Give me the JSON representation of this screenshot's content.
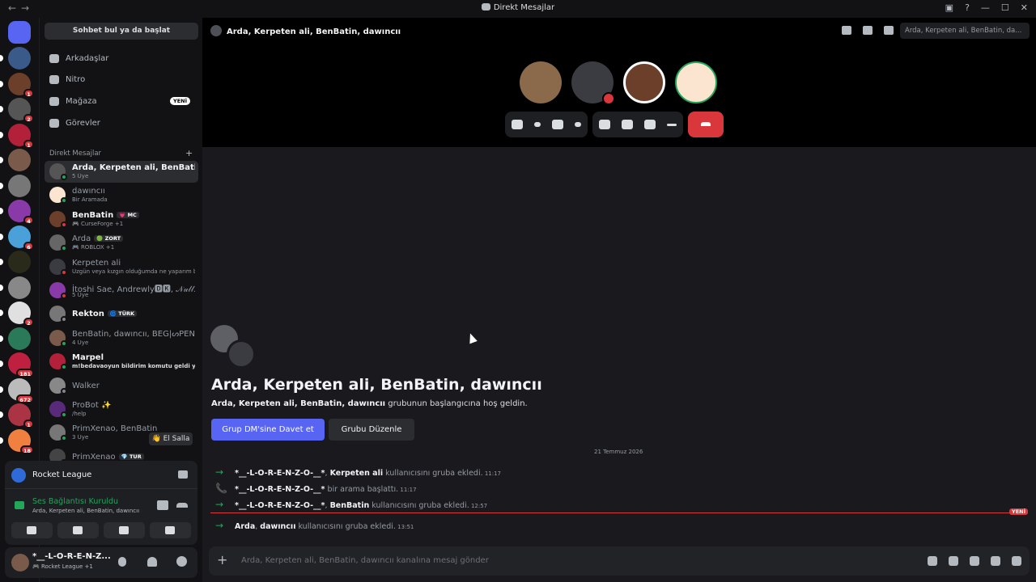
{
  "window": {
    "title": "Direkt Mesajlar"
  },
  "sidebar": {
    "search_button": "Sohbet bul ya da başlat",
    "nav": [
      {
        "label": "Arkadaşlar",
        "icon": "friends-icon"
      },
      {
        "label": "Nitro",
        "icon": "nitro-icon"
      },
      {
        "label": "Mağaza",
        "icon": "shop-icon",
        "badge": "YENİ"
      },
      {
        "label": "Görevler",
        "icon": "quests-icon"
      }
    ],
    "dm_header": "Direkt Mesajlar",
    "dms": [
      {
        "name": "Arda, Kerpeten ali, BenBatin, d...",
        "sub": "5 Üye",
        "bold": true,
        "active": true
      },
      {
        "name": "dawıncıı",
        "sub": "Bir Aramada",
        "bold": false
      },
      {
        "name": "BenBatin",
        "tag": "💗 MC",
        "sub": "🎮 CurseForge +1",
        "bold": true
      },
      {
        "name": "Arda",
        "tag": "🟢 ZORT",
        "sub": "🎮 ROBLOX +1",
        "bold": false
      },
      {
        "name": "Kerpeten ali",
        "sub": "Üzgün veya kızgın olduğumda ne yaparım b...",
        "bold": false
      },
      {
        "name": "İtoshi Sae, Andrewly🅳🅺, 𝒩𝓊𝓁𝓁...",
        "sub": "5 Üye",
        "bold": false
      },
      {
        "name": "Rekton",
        "tag": "🌀 TÜRK",
        "sub": "",
        "bold": true
      },
      {
        "name": "BenBatin, dawıncıı, BEG|ᔕPEN...",
        "sub": "4 Üye",
        "bold": false
      },
      {
        "name": "Marpel",
        "sub": "m!bedavaoyun bildirim komutu geldi yenili...",
        "bold": true,
        "sub_hl": true
      },
      {
        "name": "Walker",
        "sub": "",
        "bold": false
      },
      {
        "name": "ProBot ✨",
        "sub": "/help",
        "bold": false
      },
      {
        "name": "PrimXenao, BenBatin",
        "sub": "3 Üye",
        "bold": false
      },
      {
        "name": "PrimXenao",
        "tag": "💎 TUR",
        "sub": "",
        "bold": false
      }
    ],
    "wave_button": "👋 El Salla",
    "game": {
      "name": "Rocket League"
    },
    "voice": {
      "status": "Ses Bağlantısı Kuruldu",
      "channel": "Arda, Kerpeten ali, BenBatin, dawıncıı"
    },
    "user": {
      "name": "*__-L-O-R-E-N-Z...",
      "activity": "🎮 Rocket League +1"
    }
  },
  "servers": [
    {
      "color": "#5865f2",
      "badge": "",
      "pip": false
    },
    {
      "color": "#3a5a8a",
      "badge": "",
      "pip": true
    },
    {
      "color": "#6b3f2a",
      "badge": "1",
      "pip": true
    },
    {
      "color": "#555",
      "badge": "2",
      "pip": true
    },
    {
      "color": "#b3203a",
      "badge": "1",
      "pip": true
    },
    {
      "color": "#7a5a4a",
      "badge": "",
      "pip": true
    },
    {
      "color": "#777",
      "badge": "",
      "pip": true
    },
    {
      "color": "#8a3aa8",
      "badge": "4",
      "pip": true
    },
    {
      "color": "#4aa0d8",
      "badge": "6",
      "pip": true
    },
    {
      "color": "#2a2a1a",
      "badge": "",
      "pip": true
    },
    {
      "color": "#888",
      "badge": "",
      "pip": true
    },
    {
      "color": "#e0e0e0",
      "badge": "2",
      "pip": true
    },
    {
      "color": "#2a7a5a",
      "badge": "",
      "pip": true
    },
    {
      "color": "#c02040",
      "badge": "181",
      "pip": true
    },
    {
      "color": "#bbb",
      "badge": "672",
      "pip": true
    },
    {
      "color": "#aa3344",
      "badge": "1",
      "pip": true
    },
    {
      "color": "#f08040",
      "badge": "18",
      "pip": true
    }
  ],
  "main": {
    "channel_title": "Arda, Kerpeten ali, BenBatin, dawıncıı",
    "search_placeholder": "Arda, Kerpeten ali, BenBatin, da...",
    "welcome_title": "Arda, Kerpeten ali, BenBatin, dawıncıı",
    "welcome_names": "Arda, Kerpeten ali, BenBatin, dawıncıı",
    "welcome_suffix": " grubunun başlangıcına hoş geldin.",
    "invite_button": "Grup DM'sine Davet et",
    "edit_button": "Grubu Düzenle",
    "date": "21 Temmuz 2026",
    "new_badge": "YENİ",
    "messages": [
      {
        "icon": "→",
        "actor": "*__-L-O-R-E-N-Z-O-__*",
        "target": "Kerpeten ali",
        "text": " kullanıcısını gruba ekledi.",
        "time": "11:17"
      },
      {
        "icon": "📞",
        "actor": "*__-L-O-R-E-N-Z-O-__*",
        "target": "",
        "text": " bir arama başlattı.",
        "time": "11:17"
      },
      {
        "icon": "→",
        "actor": "*__-L-O-R-E-N-Z-O-__*",
        "target": "BenBatin",
        "text": " kullanıcısını gruba ekledi.",
        "time": "12:57"
      },
      {
        "icon": "→",
        "actor": "Arda",
        "target": "dawıncıı",
        "text": " kullanıcısını gruba ekledi.",
        "time": "13:51"
      }
    ],
    "composer_placeholder": "Arda, Kerpeten ali, BenBatin, dawıncıı kanalına mesaj gönder"
  }
}
